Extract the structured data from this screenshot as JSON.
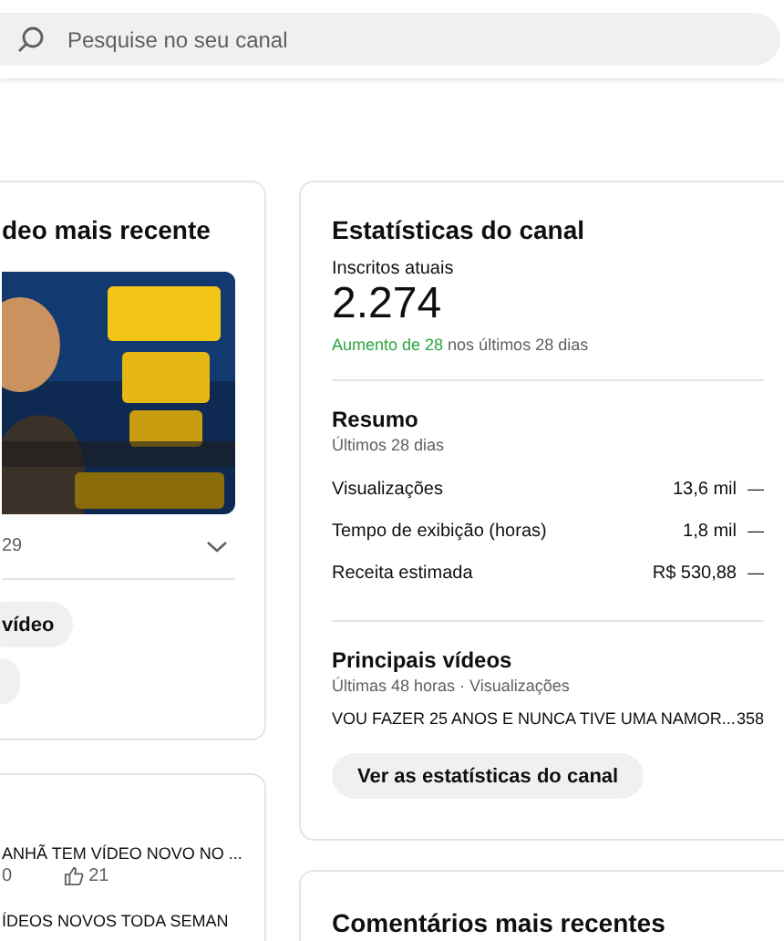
{
  "search": {
    "placeholder": "Pesquise no seu canal"
  },
  "latest_video": {
    "title": "deo mais recente",
    "thumbnail": {
      "kind": "picture"
    },
    "stat": "29",
    "buttons": [
      "vídeo"
    ]
  },
  "recent_videos": {
    "rows": [
      {
        "title": "ANHÃ TEM VÍDEO NOVO NO ...",
        "views": "0",
        "likes": "21"
      },
      {
        "title": "ÍDEOS NOVOS TODA SEMAN"
      }
    ]
  },
  "channel_stats": {
    "title": "Estatísticas do canal",
    "subscribers_label": "Inscritos atuais",
    "subscribers": "2.274",
    "growth_highlight": "Aumento de 28",
    "growth_rest": "nos últimos 28 dias",
    "summary": {
      "title": "Resumo",
      "period": "Últimos 28 dias",
      "rows": [
        {
          "label": "Visualizações",
          "value": "13,6 mil",
          "trend": "—"
        },
        {
          "label": "Tempo de exibição (horas)",
          "value": "1,8 mil",
          "trend": "—"
        },
        {
          "label": "Receita estimada",
          "value": "R$ 530,88",
          "trend": "—"
        }
      ]
    },
    "top_videos": {
      "title": "Principais vídeos",
      "period": "Últimas 48 horas · Visualizações",
      "rows": [
        {
          "title": "VOU FAZER 25 ANOS E NUNCA TIVE UMA NAMOR...",
          "views": "358"
        }
      ]
    },
    "button": "Ver as estatísticas do canal"
  },
  "comments": {
    "title": "Comentários mais recentes"
  }
}
